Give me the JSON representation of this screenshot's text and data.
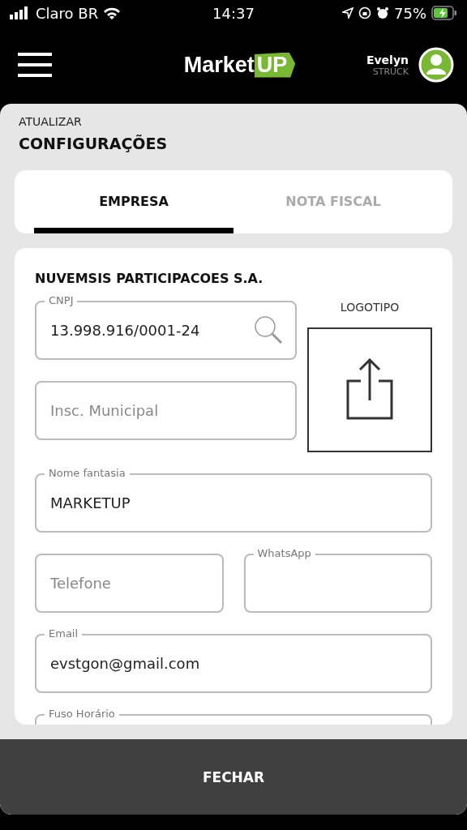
{
  "status_bar": {
    "carrier": "Claro BR",
    "time": "14:37",
    "battery": "75%"
  },
  "header": {
    "logo_main": "Market",
    "logo_badge": "UP",
    "user_name": "Evelyn",
    "user_surname": "STRUCK"
  },
  "page": {
    "overline": "ATUALIZAR",
    "title": "CONFIGURAÇÕES"
  },
  "tabs": [
    {
      "label": "EMPRESA",
      "selected": true
    },
    {
      "label": "NOTA FISCAL",
      "selected": false
    }
  ],
  "company": {
    "name": "NUVEMSIS PARTICIPACOES S.A.",
    "logo_label": "LOGOTIPO",
    "fields": [
      {
        "kind": "search",
        "label": "CNPJ",
        "value": "13.998.916/0001-24"
      },
      {
        "kind": "text",
        "placeholder": "Insc. Municipal"
      },
      {
        "kind": "text",
        "label": "Nome fantasia",
        "value": "MARKETUP"
      },
      {
        "kind": "half",
        "placeholder": "Telefone"
      },
      {
        "kind": "half",
        "label": "WhatsApp"
      },
      {
        "kind": "text",
        "label": "Email",
        "value": "evstgon@gmail.com"
      },
      {
        "kind": "text",
        "label": "Fuso Horário"
      }
    ]
  },
  "close_button": "FECHAR"
}
